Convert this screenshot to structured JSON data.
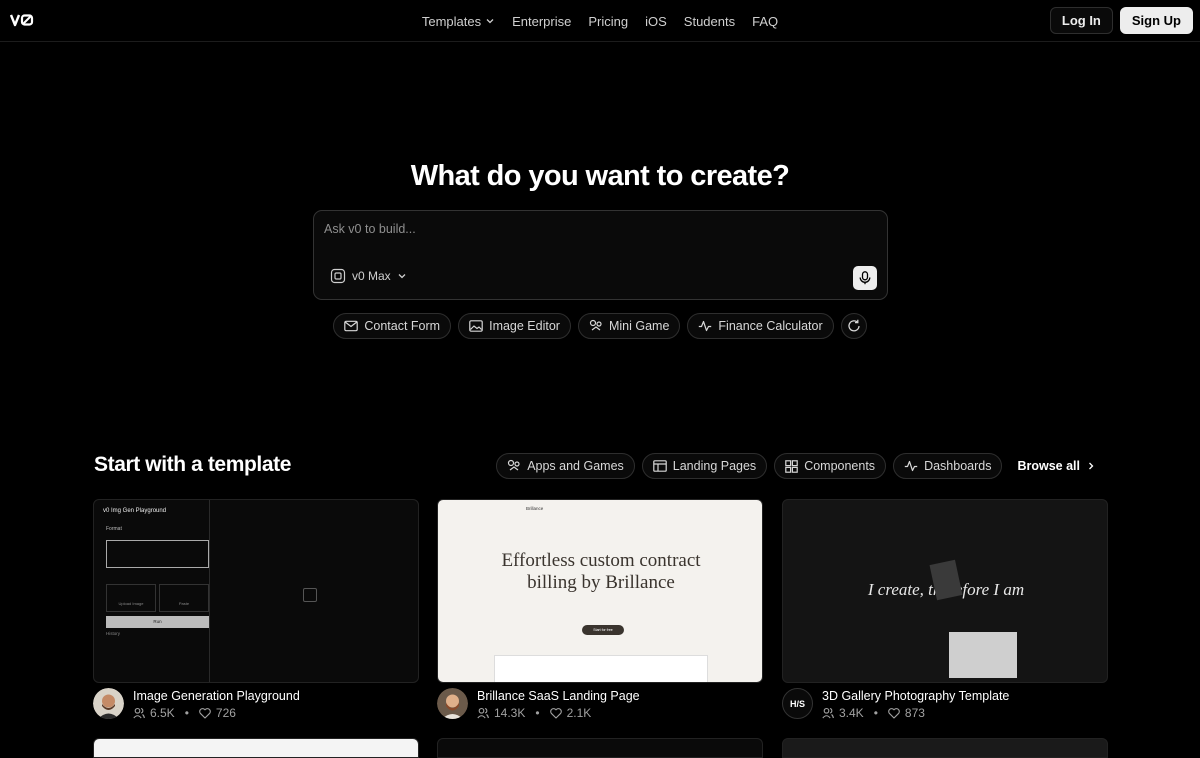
{
  "header": {
    "logo_text": "v0",
    "nav": [
      {
        "label": "Templates",
        "has_dropdown": true
      },
      {
        "label": "Enterprise"
      },
      {
        "label": "Pricing"
      },
      {
        "label": "iOS"
      },
      {
        "label": "Students"
      },
      {
        "label": "FAQ"
      }
    ],
    "login_label": "Log In",
    "signup_label": "Sign Up"
  },
  "hero": {
    "title": "What do you want to create?",
    "prompt_placeholder": "Ask v0 to build...",
    "model_label": "v0 Max",
    "suggestions": [
      {
        "label": "Contact Form",
        "icon": "mail-icon"
      },
      {
        "label": "Image Editor",
        "icon": "image-icon"
      },
      {
        "label": "Mini Game",
        "icon": "game-icon"
      },
      {
        "label": "Finance Calculator",
        "icon": "activity-icon"
      }
    ]
  },
  "templates": {
    "title": "Start with a template",
    "filters": [
      {
        "label": "Apps and Games",
        "icon": "game-icon"
      },
      {
        "label": "Landing Pages",
        "icon": "layout-icon"
      },
      {
        "label": "Components",
        "icon": "grid-icon"
      },
      {
        "label": "Dashboards",
        "icon": "activity-icon"
      }
    ],
    "browse_label": "Browse all",
    "cards": [
      {
        "title": "Image Generation Playground",
        "users": "6.5K",
        "likes": "726",
        "preview": {
          "heading": "v0 Img Gen Playground",
          "format_label": "Format",
          "upload_label": "Upload Image",
          "paste_label": "Paste",
          "run_label": "Run",
          "history_label": "History"
        }
      },
      {
        "title": "Brillance SaaS Landing Page",
        "users": "14.3K",
        "likes": "2.1K",
        "preview": {
          "brand": "Brillance",
          "headline_1": "Effortless custom contract",
          "headline_2": "billing by Brillance",
          "cta": "Start for free"
        }
      },
      {
        "title": "3D Gallery Photography Template",
        "users": "3.4K",
        "likes": "873",
        "avatar_text": "H/S",
        "preview": {
          "headline": "I create, therefore I am"
        }
      }
    ]
  },
  "colors": {
    "background": "#000000",
    "border": "#2e2e2e",
    "text": "#ededed",
    "muted": "#a1a1a1"
  }
}
